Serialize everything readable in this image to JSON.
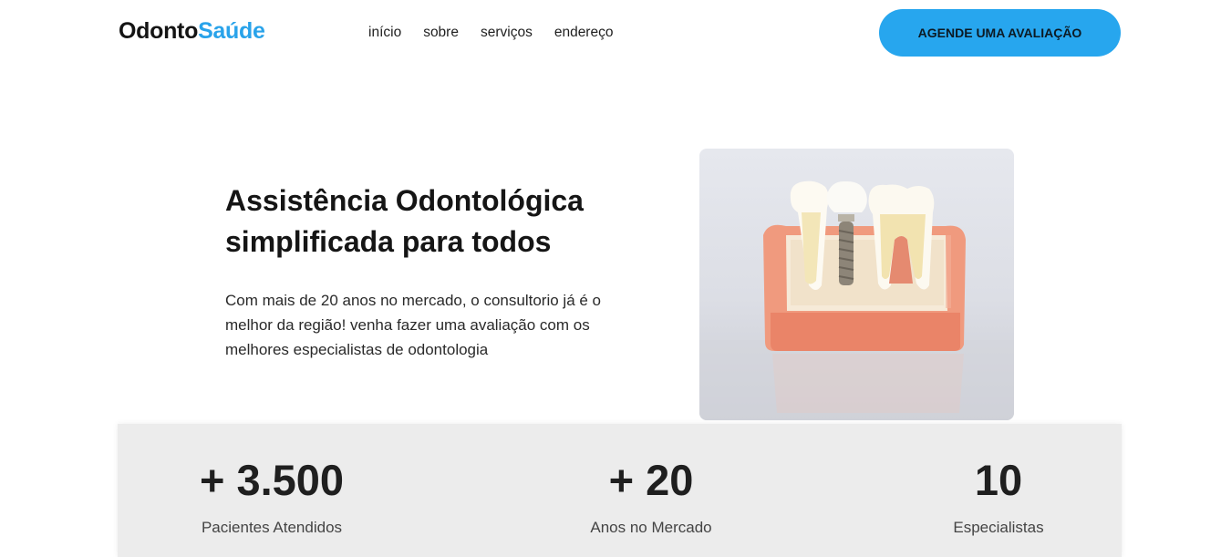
{
  "header": {
    "logo_part1": "Odonto",
    "logo_part2": "Saúde",
    "nav": [
      "início",
      "sobre",
      "serviços",
      "endereço"
    ],
    "cta_label": "AGENDE UMA AVALIAÇÃO"
  },
  "hero": {
    "title_line1": "Assistência Odontológica",
    "title_line2": "simplificada para todos",
    "text_line1": "Com mais de 20 anos no mercado, o consultorio já é o",
    "text_line2": "melhor da região! venha fazer uma avaliação com os",
    "text_line3": "melhores especialistas de odontologia"
  },
  "stats": [
    {
      "value": "+ 3.500",
      "label": "Pacientes Atendidos"
    },
    {
      "value": "+ 20",
      "label": "Anos no Mercado"
    },
    {
      "value": "10",
      "label": "Especialistas"
    }
  ],
  "colors": {
    "accent": "#27a6ee",
    "stats_bg": "#ececec",
    "gum": "#f0967a"
  }
}
